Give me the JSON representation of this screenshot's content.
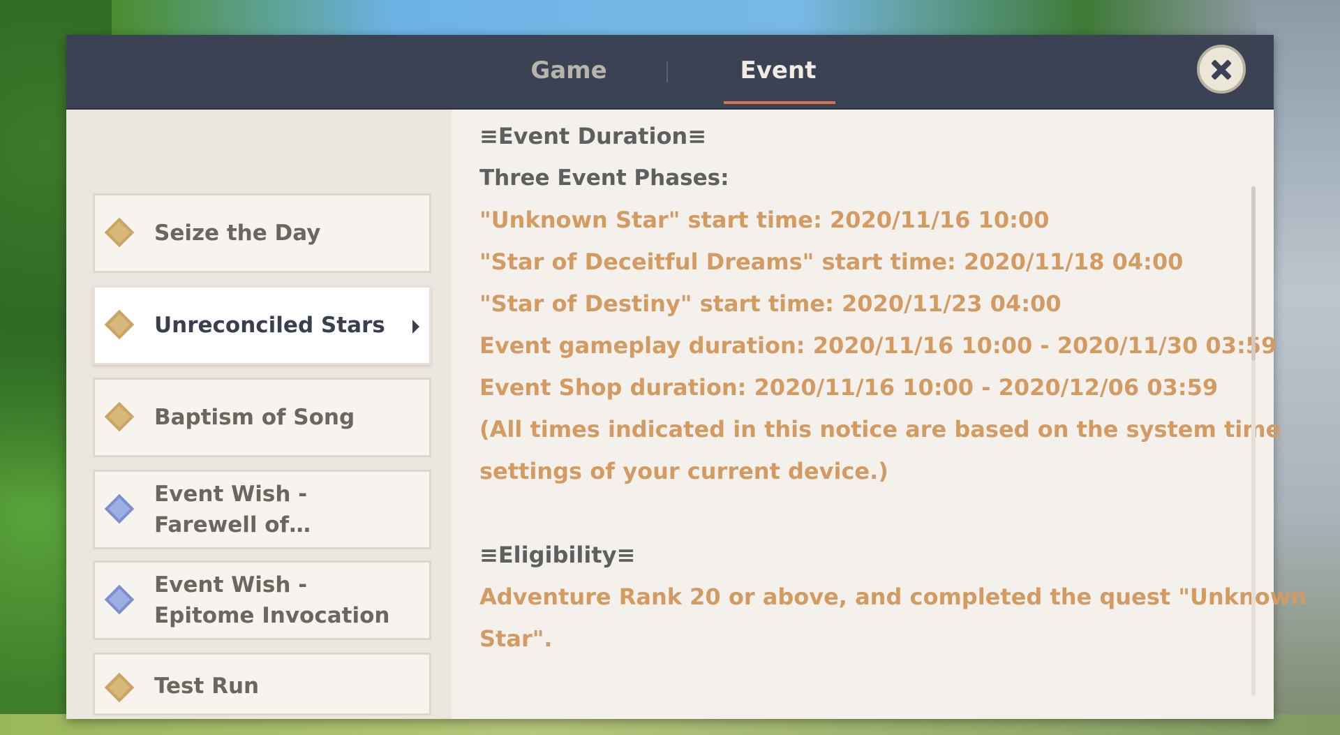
{
  "tabs": [
    {
      "label": "Game"
    },
    {
      "label": "Event"
    }
  ],
  "sidebar": {
    "items": [
      {
        "label": "Seize the Day",
        "icon": "diamond-flag-icon",
        "active": false
      },
      {
        "label": "Unreconciled Stars",
        "icon": "diamond-flag-icon",
        "active": true
      },
      {
        "label": "Baptism of Song",
        "icon": "diamond-flag-icon",
        "active": false
      },
      {
        "label": "Event Wish - Farewell of…",
        "icon": "wish-star-icon",
        "active": false
      },
      {
        "label": "Event Wish - Epitome Invocation",
        "icon": "wish-star-icon",
        "active": false
      },
      {
        "label": "Test Run",
        "icon": "diamond-flag-icon",
        "active": false
      }
    ]
  },
  "content": {
    "duration_heading": "≡Event Duration≡",
    "phases_title": "Three Event Phases:",
    "phase1": "\"Unknown Star\" start time: 2020/11/16 10:00",
    "phase2": "\"Star of Deceitful Dreams\" start time: 2020/11/18 04:00",
    "phase3": "\"Star of Destiny\" start time: 2020/11/23 04:00",
    "gameplay": "Event gameplay duration: 2020/11/16 10:00  -  2020/11/30 03:59",
    "shop": "Event Shop duration: 2020/11/16 10:00  -  2020/12/06 03:59",
    "note_line1": "(All times indicated in this notice are based on the system time",
    "note_line2": "settings of your current device.)",
    "eligibility_heading": "≡Eligibility≡",
    "eligibility_line1": "Adventure Rank 20 or above, and completed the quest \"Unknown",
    "eligibility_line2": "Star\"."
  },
  "colors": {
    "header_bg": "#3b4253",
    "accent_underline": "#d9724f",
    "highlight_text": "#d39b62",
    "panel_bg": "#f4f1ec"
  }
}
